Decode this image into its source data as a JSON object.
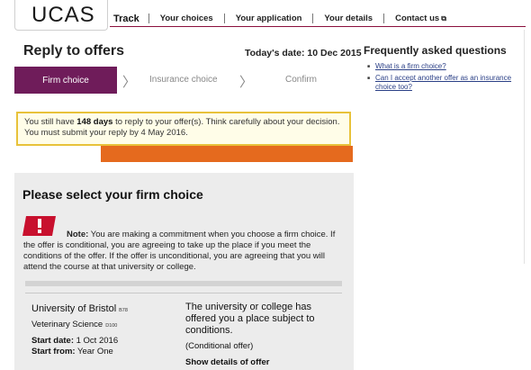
{
  "header": {
    "logo": "UCAS",
    "track": "Track",
    "nav": [
      "Your choices",
      "Your application",
      "Your details",
      "Contact us"
    ]
  },
  "page": {
    "title": "Reply to offers",
    "todays_date": "Today's date: 10 Dec 2015"
  },
  "steps": {
    "firm": "Firm choice",
    "insurance": "Insurance choice",
    "confirm": "Confirm",
    "arrow": "〉"
  },
  "notice": {
    "prefix": "You still have ",
    "days": "148 days",
    "suffix": " to reply to your offer(s). Think carefully about your decision.",
    "line2": "You must submit your reply by 4 May 2016."
  },
  "faq": {
    "title": "Frequently asked questions",
    "items": [
      "What is a firm choice?",
      "Can I accept another offer as an insurance choice too?"
    ]
  },
  "firm_panel": {
    "title": "Please select your firm choice",
    "note_label": "Note:",
    "note_text": " You are making a commitment when you choose a firm choice. If the offer is conditional, you are agreeing to take up the place if you meet the conditions of the offer. If the offer is unconditional, you are agreeing that you will attend the course at that university or college."
  },
  "offer": {
    "university": "University of Bristol",
    "university_code": "B78",
    "course": "Veterinary Science",
    "course_code": "D100",
    "start_date_label": "Start date:",
    "start_date": " 1 Oct 2016",
    "start_from_label": "Start from:",
    "start_from": " Year One",
    "offer_text": "The university or college has offered you a place subject to conditions.",
    "offer_type": "(Conditional offer)",
    "show_details": "Show details of offer"
  },
  "colors": {
    "accent_purple": "#6f1c5a",
    "notice_border": "#e8c23a",
    "orange": "#e56a1e",
    "warning_red": "#c8102e"
  }
}
